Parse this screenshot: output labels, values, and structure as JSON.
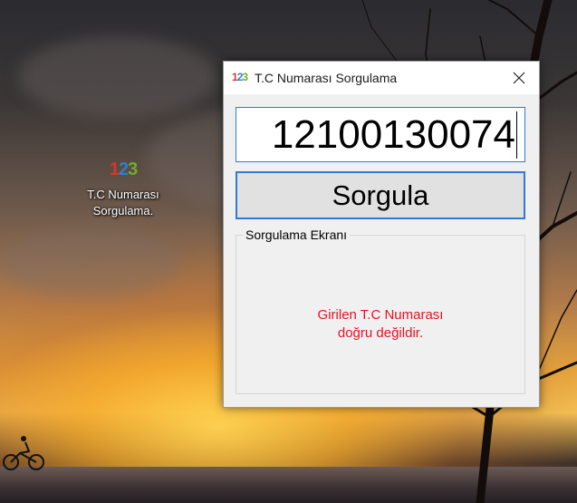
{
  "desktop": {
    "icon": {
      "logo_digits": [
        "1",
        "2",
        "3"
      ],
      "label_line1": "T.C Numarası",
      "label_line2": "Sorgulama."
    }
  },
  "window": {
    "title": "T.C Numarası Sorgulama",
    "app_icon_digits": [
      "1",
      "2",
      "3"
    ],
    "close_icon": "close-icon"
  },
  "form": {
    "tc_input_value": "12100130074",
    "query_button_label": "Sorgula",
    "group_title": "Sorgulama Ekranı",
    "result_line1": "Girilen T.C Numarası",
    "result_line2": "doğru değildir."
  },
  "colors": {
    "accent": "#2f7bd4",
    "error_text": "#e81123",
    "logo_1": "#d23a2a",
    "logo_2": "#2e7fd0",
    "logo_3": "#6fae2b"
  }
}
